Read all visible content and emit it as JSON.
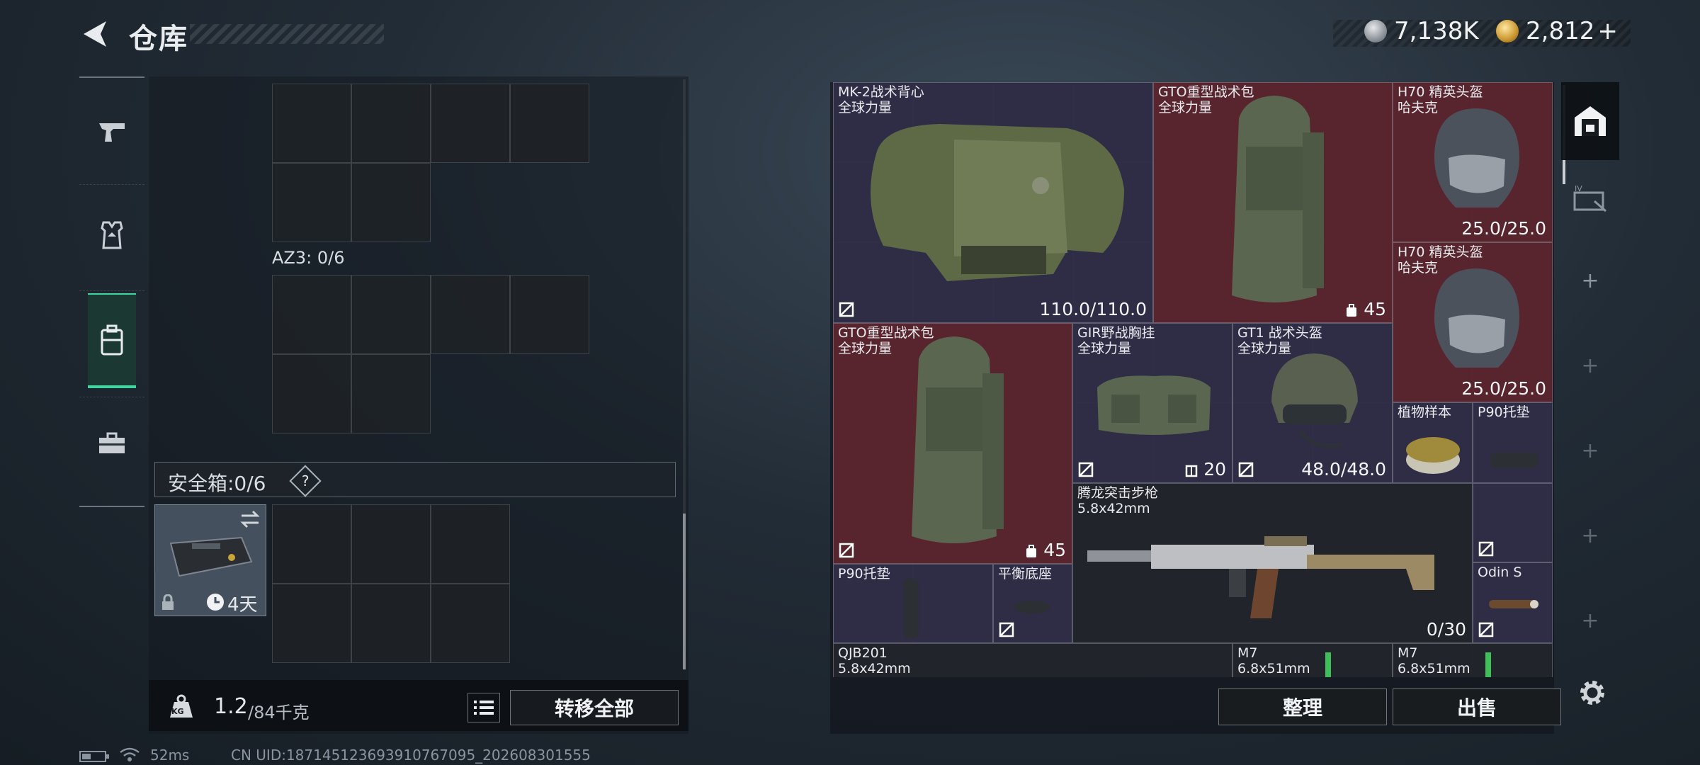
{
  "header": {
    "title": "仓库",
    "currency_silver": "7,138K",
    "currency_gold": "2,812",
    "currency_add": "+"
  },
  "sidebar": {
    "items": [
      {
        "name": "weapons",
        "icon": "pistol-icon"
      },
      {
        "name": "gear",
        "icon": "armor-icon"
      },
      {
        "name": "backpack",
        "icon": "backpack-icon",
        "active": true
      },
      {
        "name": "items",
        "icon": "toolbox-icon"
      }
    ]
  },
  "left_panel": {
    "container_label": "AZ3: 0/6",
    "safebox_label": "安全箱:0/6",
    "safebox_help": "?",
    "safebox_time": "4天",
    "weight_value": "1.2",
    "weight_max": "/84千克",
    "weight_icon_text": "KG",
    "transfer_all": "转移全部"
  },
  "inventory": {
    "items": [
      {
        "name": "MK-2战术背心",
        "sub": "全球力量",
        "value": "110.0/110.0",
        "rarity": "purple"
      },
      {
        "name": "GTO重型战术包",
        "sub": "全球力量",
        "value": "45",
        "rarity": "red"
      },
      {
        "name": "H70 精英头盔",
        "sub": "哈夫克",
        "value": "25.0/25.0",
        "rarity": "red"
      },
      {
        "name": "H70 精英头盔",
        "sub": "哈夫克",
        "value": "25.0/25.0",
        "rarity": "red"
      },
      {
        "name": "GTO重型战术包",
        "sub": "全球力量",
        "value": "45",
        "rarity": "red"
      },
      {
        "name": "GIR野战胸挂",
        "sub": "全球力量",
        "value": "20",
        "rarity": "purple"
      },
      {
        "name": "GT1 战术头盔",
        "sub": "全球力量",
        "value": "48.0/48.0",
        "rarity": "purple"
      },
      {
        "name": "植物样本",
        "sub": "",
        "value": "",
        "rarity": "purple"
      },
      {
        "name": "P90托垫",
        "sub": "",
        "value": "",
        "rarity": "purple"
      },
      {
        "name": "腾龙突击步枪",
        "sub": "5.8x42mm",
        "value": "0/30",
        "rarity": "dark"
      },
      {
        "name": "P90托垫",
        "sub": "",
        "value": "",
        "rarity": "purple"
      },
      {
        "name": "平衡底座",
        "sub": "",
        "value": "",
        "rarity": "purple"
      },
      {
        "name": "Odin S",
        "sub": "",
        "value": "",
        "rarity": "purple"
      },
      {
        "name": "QJB201",
        "sub": "5.8x42mm",
        "value": "",
        "rarity": "dark"
      },
      {
        "name": "M7",
        "sub": "6.8x51mm",
        "value": "",
        "rarity": "dark"
      },
      {
        "name": "M7",
        "sub": "6.8x51mm",
        "value": "",
        "rarity": "dark"
      }
    ],
    "sort_button": "整理",
    "sell_button": "出售"
  },
  "status_bar": {
    "ping": "52ms",
    "uid": "CN UID:187145123693910767095_202608301555"
  },
  "colors": {
    "accent": "#3fd6a0",
    "rarity_red": "#5c242c",
    "rarity_purple": "#302e48"
  }
}
